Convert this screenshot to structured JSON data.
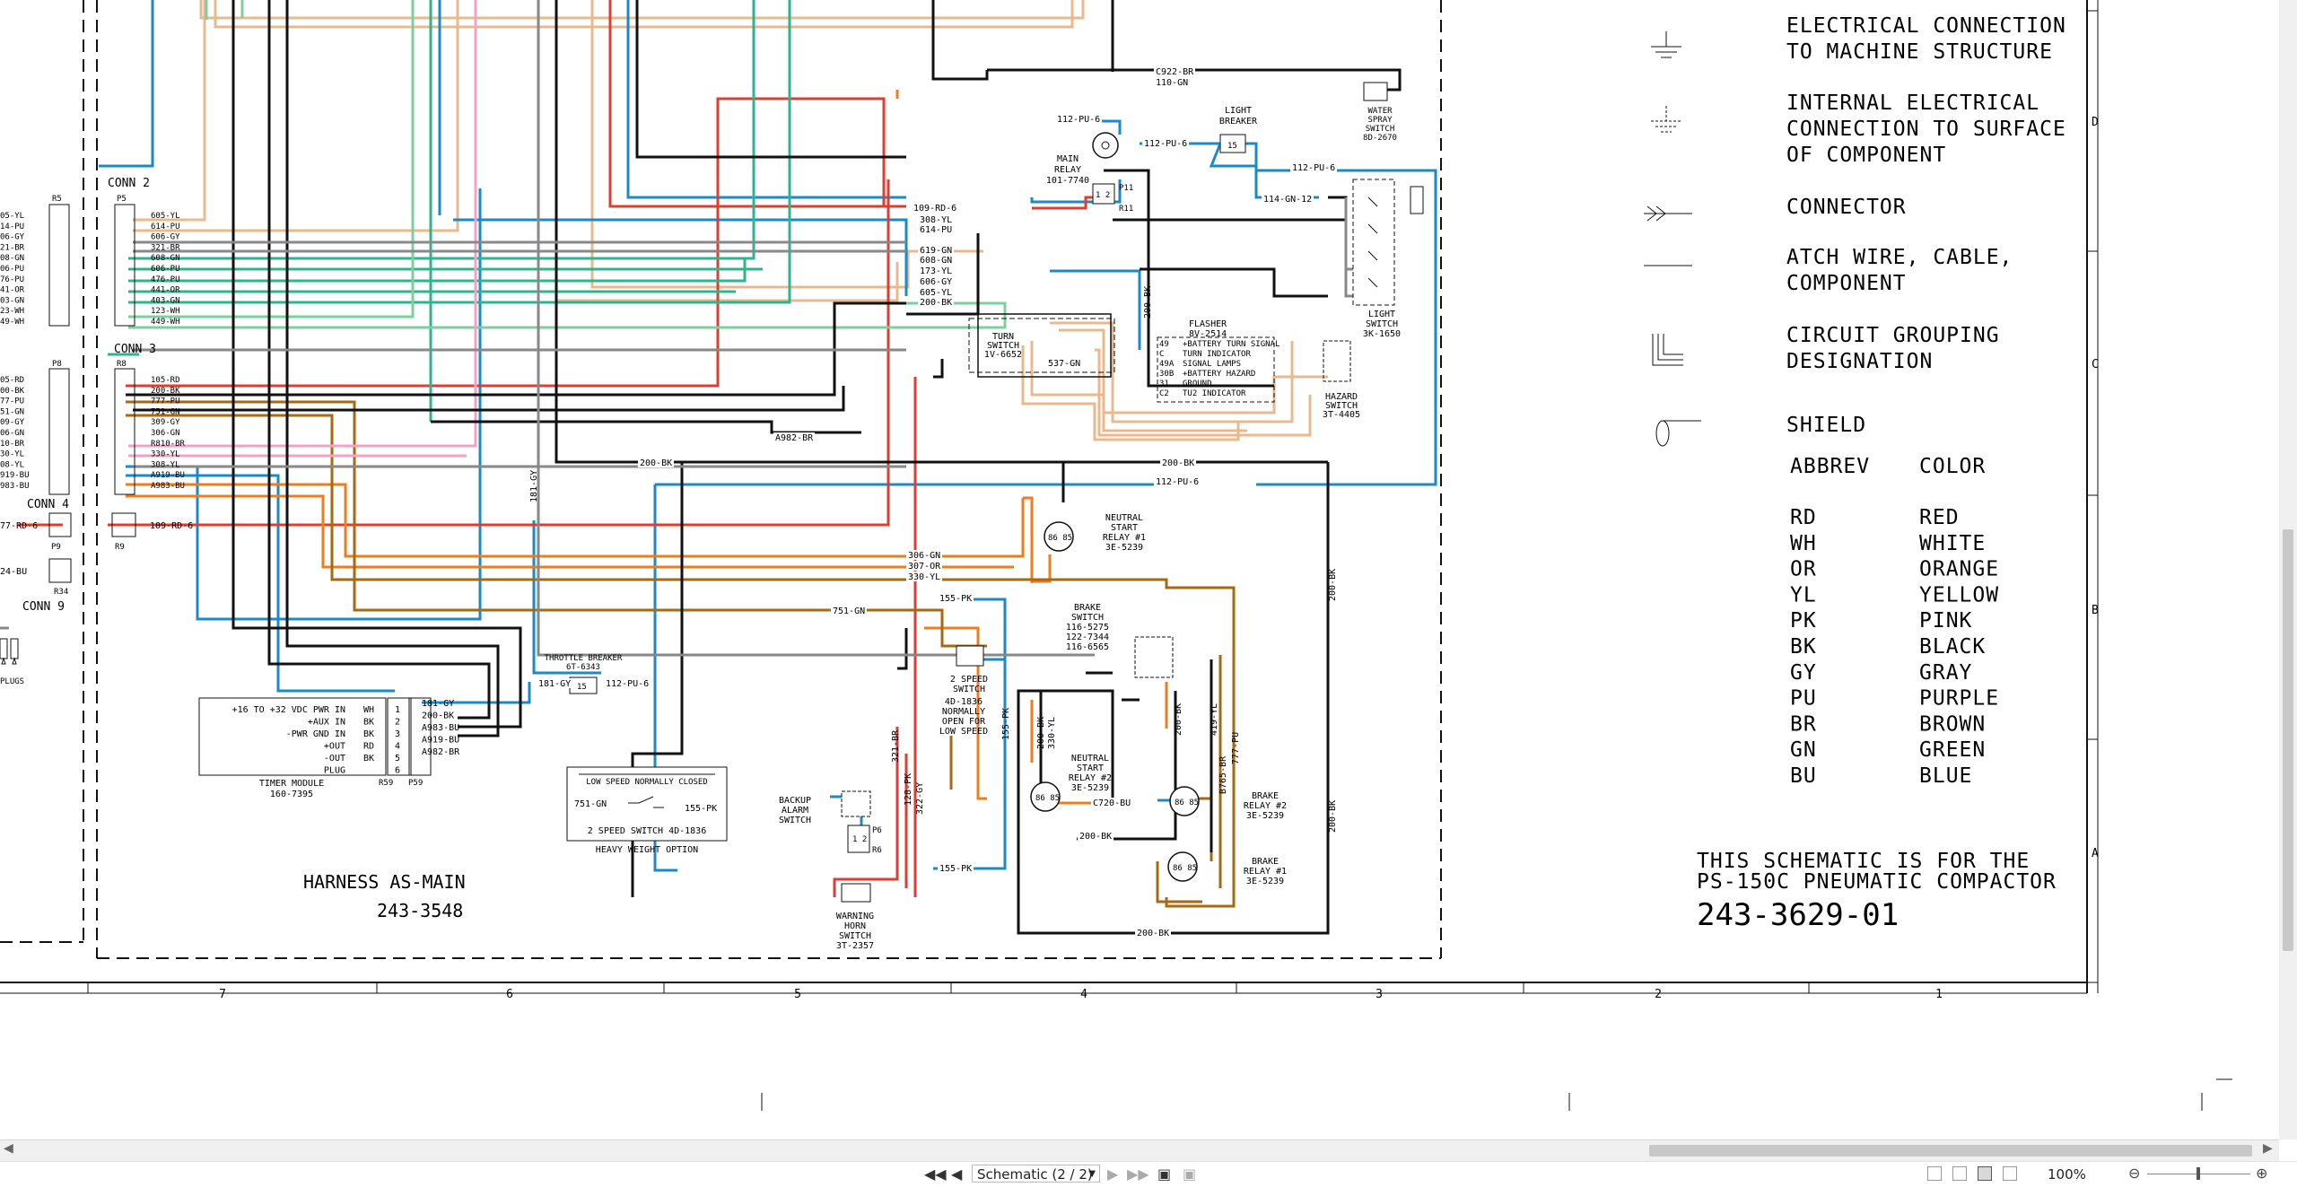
{
  "colors": {
    "red": "#e03c31",
    "orange": "#f07d1d",
    "tan": "#e8b98d",
    "blue": "#1a8ac9",
    "teal": "#2fb58e",
    "mint": "#7ecfa0",
    "brown": "#a56a12",
    "black": "#111111",
    "pink": "#f2a3c5",
    "purple": "#9b59b6",
    "gray": "#888888"
  },
  "legend": {
    "items": [
      {
        "icon": "ground-icon",
        "lines": [
          "ELECTRICAL CONNECTION",
          "TO MACHINE STRUCTURE"
        ]
      },
      {
        "icon": "frame-ground-icon",
        "lines": [
          "INTERNAL ELECTRICAL",
          "CONNECTION TO SURFACE",
          "OF COMPONENT"
        ]
      },
      {
        "icon": "connector-icon",
        "lines": [
          "CONNECTOR"
        ]
      },
      {
        "icon": "wire-icon",
        "lines": [
          "ATCH WIRE, CABLE,",
          "COMPONENT"
        ]
      },
      {
        "icon": "grouping-icon",
        "lines": [
          "CIRCUIT GROUPING",
          "DESIGNATION"
        ]
      },
      {
        "icon": "shield-icon",
        "lines": [
          "SHIELD"
        ]
      }
    ],
    "abbrev_header": "ABBREV",
    "color_header": "COLOR",
    "abbreviations": [
      {
        "abbr": "RD",
        "color": "RED"
      },
      {
        "abbr": "WH",
        "color": "WHITE"
      },
      {
        "abbr": "OR",
        "color": "ORANGE"
      },
      {
        "abbr": "YL",
        "color": "YELLOW"
      },
      {
        "abbr": "PK",
        "color": "PINK"
      },
      {
        "abbr": "BK",
        "color": "BLACK"
      },
      {
        "abbr": "GY",
        "color": "GRAY"
      },
      {
        "abbr": "PU",
        "color": "PURPLE"
      },
      {
        "abbr": "BR",
        "color": "BROWN"
      },
      {
        "abbr": "GN",
        "color": "GREEN"
      },
      {
        "abbr": "BU",
        "color": "BLUE"
      }
    ],
    "note_line1": "THIS SCHEMATIC IS FOR THE",
    "note_line2": "PS-150C PNEUMATIC COMPACTOR",
    "doc_number": "243-3629-01"
  },
  "border": {
    "col_labels": [
      "7",
      "6",
      "5",
      "4",
      "3",
      "2",
      "1"
    ],
    "row_labels": [
      "D",
      "C",
      "B",
      "A"
    ]
  },
  "harness": {
    "title": "HARNESS AS-MAIN",
    "number": "243-3548"
  },
  "connectors": {
    "conn2": {
      "label": "CONN 2",
      "plug": "P5",
      "recept": "R5",
      "wires": [
        "605-YL",
        "614-PU",
        "606-GY",
        "321-BR",
        "608-GN",
        "606-PU",
        "476-PU",
        "441-OR",
        "403-GN",
        "123-WH",
        "449-WH"
      ],
      "left": [
        "05-YL",
        "14-PU",
        "06-GY",
        "21-BR",
        "08-GN",
        "06-PU",
        "76-PU",
        "41-OR",
        "03-GN",
        "23-WH",
        "49-WH"
      ]
    },
    "conn3": {
      "label": "CONN 3",
      "plug": "R8",
      "recept": "P8",
      "wires": [
        "105-RD",
        "200-BK",
        "777-PU",
        "751-GN",
        "309-GY",
        "306-GN",
        "R810-BR",
        "330-YL",
        "308-YL",
        "A919-BU",
        "A983-BU"
      ],
      "left": [
        "05-RD",
        "00-BK",
        "77-PU",
        "51-GN",
        "09-GY",
        "06-GN",
        "10-BR",
        "30-YL",
        "08-YL",
        "919-BU",
        "983-BU"
      ]
    },
    "conn4": {
      "label": "CONN 4",
      "plug": "R9",
      "recept": "P9",
      "wire": "109-RD-6",
      "left": "77-RD-6"
    },
    "conn9": {
      "label": "CONN 9",
      "recept": "R34",
      "left": "24-BU"
    },
    "plugs": "PLUGS"
  },
  "timer": {
    "lines": [
      "+16 TO +32 VDC PWR IN",
      "+AUX IN",
      "-PWR GND IN",
      "+OUT",
      "-OUT",
      "PLUG"
    ],
    "codes": [
      "WH",
      "BK",
      "BK",
      "RD",
      "BK",
      ""
    ],
    "pins": [
      "1",
      "2",
      "3",
      "4",
      "5",
      "6"
    ],
    "wires": [
      "181-GY",
      "200-BK",
      "A983-BU",
      "A919-BU",
      "A982-BR"
    ],
    "name": "TIMER MODULE",
    "part": "160-7395",
    "r": "R59",
    "p": "P59"
  },
  "components": {
    "main_relay": [
      "MAIN",
      "RELAY",
      "101-7740"
    ],
    "light_breaker": [
      "LIGHT",
      "BREAKER"
    ],
    "water_switch": [
      "WATER",
      "SPRAY",
      "SWITCH",
      "8D-2670"
    ],
    "light_switch": [
      "LIGHT",
      "SWITCH",
      "3K-1650"
    ],
    "turn_switch": [
      "TURN",
      "SWITCH",
      "1V-6652"
    ],
    "flasher": {
      "name": "FLASHER",
      "part": "8V-2514",
      "pins": [
        "49",
        "C",
        "49A",
        "30B",
        "31",
        "C2"
      ],
      "functions": [
        "+BATTERY TURN SIGNAL",
        "TURN INDICATOR",
        "SIGNAL LAMPS",
        "+BATTERY HAZARD",
        "GROUND",
        "TU2 INDICATOR"
      ]
    },
    "hazard_switch": [
      "HAZARD",
      "SWITCH",
      "3T-4405"
    ],
    "neutral1": [
      "NEUTRAL",
      "START",
      "RELAY #1",
      "3E-5239"
    ],
    "brake_switch": [
      "BRAKE",
      "SWITCH",
      "116-5275",
      "122-7344",
      "116-6565"
    ],
    "speed_switch": [
      "2 SPEED",
      "SWITCH",
      "4D-1836",
      "NORMALLY",
      "OPEN FOR",
      "LOW SPEED"
    ],
    "neutral2": [
      "NEUTRAL",
      "START",
      "RELAY #2",
      "3E-5239"
    ],
    "brake2": [
      "BRAKE",
      "RELAY #2",
      "3E-5239"
    ],
    "brake1": [
      "BRAKE",
      "RELAY #1",
      "3E-5239"
    ],
    "throttle": [
      "THROTTLE BREAKER",
      "6T-6343"
    ],
    "backup": [
      "BACKUP",
      "ALARM",
      "SWITCH"
    ],
    "horn": [
      "WARNING",
      "HORN",
      "SWITCH",
      "3T-2357"
    ],
    "low_speed_box": {
      "title": "LOW SPEED NORMALLY CLOSED",
      "left": "751-GN",
      "right": "155-PK",
      "bottom": "2 SPEED SWITCH 4D-1836"
    },
    "heavy_weight": "HEAVY WEIGHT OPTION"
  },
  "wire_labels": [
    {
      "id": "c922",
      "text": "C922-BR"
    },
    {
      "id": "w110",
      "text": "110-GN"
    },
    {
      "id": "pu6a",
      "text": "112-PU-6"
    },
    {
      "id": "pu6b",
      "text": "112-PU-6"
    },
    {
      "id": "pu6c",
      "text": "112-PU-6"
    },
    {
      "id": "gn12",
      "text": "114-GN-12"
    },
    {
      "id": "pu6d",
      "text": "112-PU-6"
    },
    {
      "id": "rd6",
      "text": "109-RD-6"
    },
    {
      "id": "yl308",
      "text": "308-YL"
    },
    {
      "id": "pu614",
      "text": "614-PU"
    },
    {
      "id": "gn619",
      "text": "619-GN"
    },
    {
      "id": "gn608",
      "text": "608-GN"
    },
    {
      "id": "yl173",
      "text": "173-YL"
    },
    {
      "id": "gy606",
      "text": "606-GY"
    },
    {
      "id": "yl605",
      "text": "605-YL"
    },
    {
      "id": "bk200a",
      "text": "200-BK"
    },
    {
      "id": "bk200v",
      "text": "200-BK"
    },
    {
      "id": "gn537",
      "text": "537-GN"
    },
    {
      "id": "bk200b",
      "text": "200-BK"
    },
    {
      "id": "bk200c",
      "text": "200-BK"
    },
    {
      "id": "pu6e",
      "text": "112-PU-6"
    },
    {
      "id": "br982",
      "text": "A982-BR"
    },
    {
      "id": "gy181",
      "text": "181-GY"
    },
    {
      "id": "gn306",
      "text": "306-GN"
    },
    {
      "id": "or307",
      "text": "307-OR"
    },
    {
      "id": "yl330",
      "text": "330-YL"
    },
    {
      "id": "gn751",
      "text": "751-GN"
    },
    {
      "id": "pk155a",
      "text": "155-PK"
    },
    {
      "id": "bk200d",
      "text": "200-BK"
    },
    {
      "id": "bk200e",
      "text": "200-BK"
    },
    {
      "id": "pk155v",
      "text": "155-PK"
    },
    {
      "id": "bk200f",
      "text": "200-BK"
    },
    {
      "id": "yl330v",
      "text": "330-YL"
    },
    {
      "id": "bk200g",
      "text": "200-BK"
    },
    {
      "id": "yl419",
      "text": "419-YL"
    },
    {
      "id": "br765",
      "text": "B765-BR"
    },
    {
      "id": "pu777",
      "text": "777-PU"
    },
    {
      "id": "bu720",
      "text": "C720-BU"
    },
    {
      "id": "bk200h",
      "text": "200-BK"
    },
    {
      "id": "br321",
      "text": "321-BR"
    },
    {
      "id": "pk128",
      "text": "128-PK"
    },
    {
      "id": "gy322",
      "text": "322-GY"
    },
    {
      "id": "pk155b",
      "text": "155-PK"
    },
    {
      "id": "bk200i",
      "text": "200-BK"
    },
    {
      "id": "gy181b",
      "text": "181-GY"
    },
    {
      "id": "pu6f",
      "text": "112-PU-6"
    }
  ],
  "toolbar": {
    "page_select": "Schematic (2 / 2)",
    "zoom": "100%"
  }
}
